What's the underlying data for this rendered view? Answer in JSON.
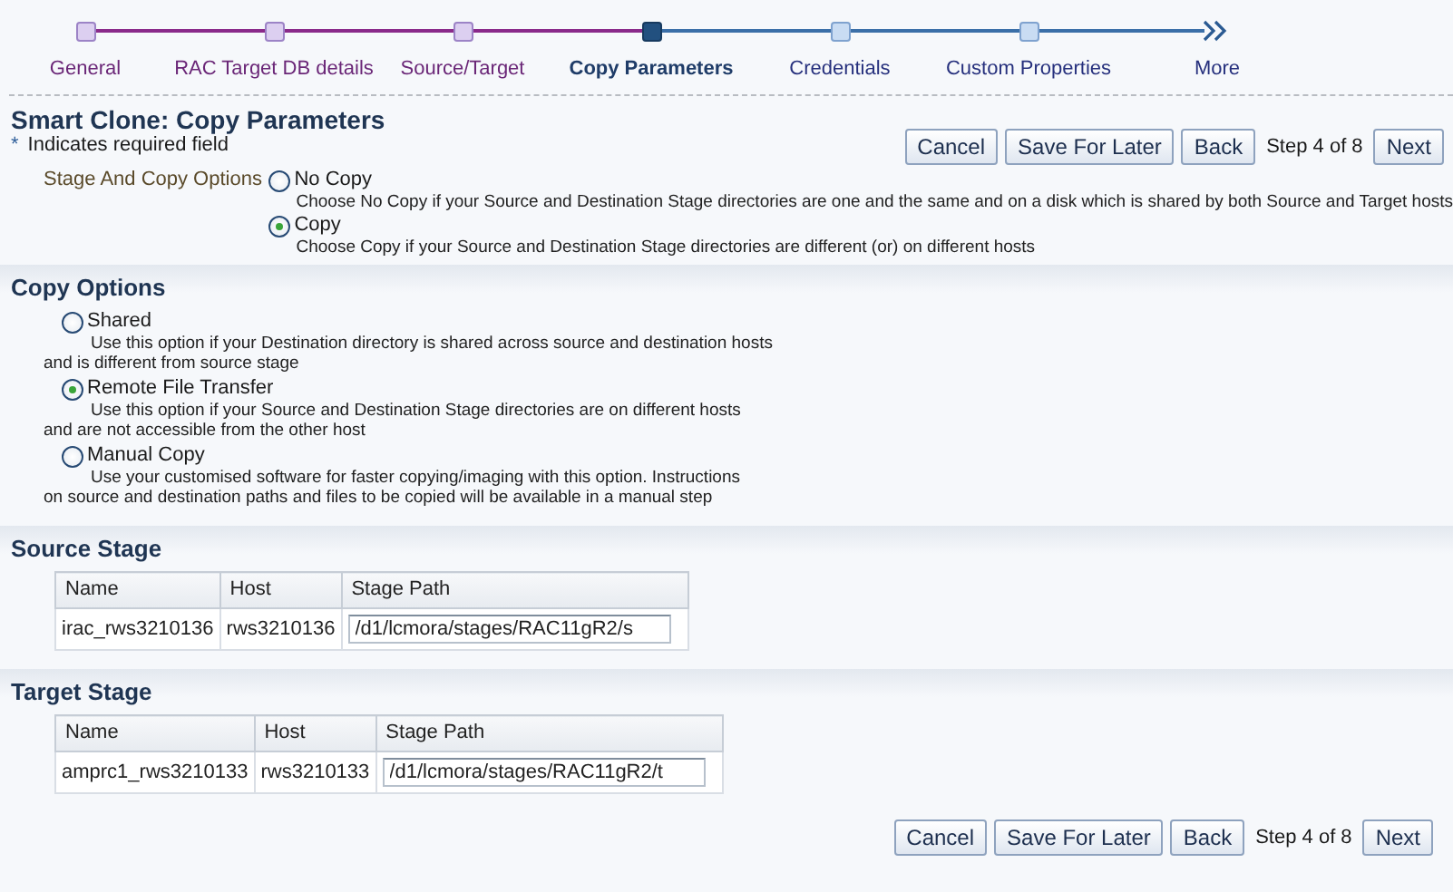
{
  "train": {
    "steps": [
      {
        "label": "General",
        "kind": "stop",
        "visited": true,
        "selected": false
      },
      {
        "label": "RAC Target DB details",
        "kind": "stop",
        "visited": true,
        "selected": false
      },
      {
        "label": "Source/Target",
        "kind": "stop",
        "visited": true,
        "selected": false
      },
      {
        "label": "Copy Parameters",
        "kind": "stop",
        "visited": false,
        "selected": true
      },
      {
        "label": "Credentials",
        "kind": "stop",
        "visited": false,
        "selected": false
      },
      {
        "label": "Custom Properties",
        "kind": "stop",
        "visited": false,
        "selected": false
      },
      {
        "label": "More",
        "kind": "more",
        "visited": false,
        "selected": false
      }
    ]
  },
  "title": "Smart Clone: Copy Parameters",
  "required_note": {
    "mark": "*",
    "text": "Indicates required field"
  },
  "top_buttons": {
    "cancel": "Cancel",
    "save": "Save For Later",
    "back": "Back",
    "step": "Step 4 of 8",
    "next": "Next"
  },
  "stage_and_copy": {
    "label": "Stage And Copy Options",
    "options": [
      {
        "label": "No Copy",
        "description": "Choose No Copy if your Source and Destination Stage directories are one and the same and on a disk which is shared by both Source and Target hosts",
        "selected": false
      },
      {
        "label": "Copy",
        "description": "Choose Copy if your Source and Destination Stage directories are different (or) on different hosts",
        "selected": true
      }
    ]
  },
  "copy_options": {
    "title": "Copy Options",
    "options": [
      {
        "label": "Shared",
        "description": "Use this option if your Destination directory is shared across source and destination hosts",
        "description_2": "and is different from source stage",
        "selected": false
      },
      {
        "label": "Remote File Transfer",
        "description": "Use this option if your Source and Destination Stage directories are on different hosts",
        "description_2": "and are not accessible from the other host",
        "selected": true
      },
      {
        "label": "Manual Copy",
        "description": "Use your customised software for faster copying/imaging with this option. Instructions",
        "description_2": "on source and destination paths and files to be copied will be available in a manual step",
        "selected": false
      }
    ]
  },
  "source_stage": {
    "title": "Source Stage",
    "columns": [
      "Name",
      "Host",
      "Stage Path"
    ],
    "rows": [
      {
        "name": "irac_rws3210136",
        "host": "rws3210136",
        "stage_path": "/d1/lcmora/stages/RAC11gR2/s"
      }
    ]
  },
  "target_stage": {
    "title": "Target Stage",
    "columns": [
      "Name",
      "Host",
      "Stage Path"
    ],
    "rows": [
      {
        "name": "amprc1_rws3210133",
        "host": "rws3210133",
        "stage_path": "/d1/lcmora/stages/RAC11gR2/t"
      }
    ]
  },
  "bottom_buttons": {
    "cancel": "Cancel",
    "save": "Save For Later",
    "back": "Back",
    "step": "Step 4 of 8",
    "next": "Next"
  }
}
